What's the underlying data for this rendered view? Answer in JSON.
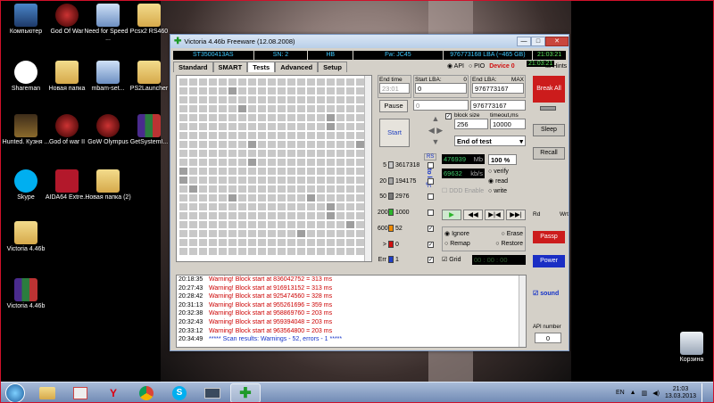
{
  "desktop": {
    "icons": [
      {
        "label": "Компьютер"
      },
      {
        "label": "God Of War"
      },
      {
        "label": "Need for Speed - ..."
      },
      {
        "label": "Pcsx2 RS460"
      },
      {
        "label": "Shareman"
      },
      {
        "label": "Новая папка"
      },
      {
        "label": "mbam-set..."
      },
      {
        "label": "PS2Launcher"
      },
      {
        "label": "Hunted. Кузня ..."
      },
      {
        "label": "God of war II"
      },
      {
        "label": "GoW Olympus"
      },
      {
        "label": "GetSystemI..."
      },
      {
        "label": "Skype"
      },
      {
        "label": "AIDA64 Extre..."
      },
      {
        "label": "Новая папка (2)"
      },
      {
        "label": "Victoria 4.46b"
      },
      {
        "label": "Victoria 4.46b"
      }
    ],
    "recycle_bin": "Корзина"
  },
  "window": {
    "title": "Victoria 4.46b Freeware (12.08.2008)",
    "controls": {
      "minimize": "—",
      "maximize": "□",
      "close": "✕"
    },
    "info": {
      "model": "ST3500413AS",
      "sn": "SN: 2",
      "sn_unit": "HB",
      "fw": "Fw: JC45",
      "lba": "976773168 LBA (~465 GB)",
      "clock": "21:03:21"
    },
    "tabs": [
      "Standard",
      "SMART",
      "Tests",
      "Advanced",
      "Setup"
    ],
    "api": "API",
    "pio": "PIO",
    "device": "Device 0",
    "hints": "Hints",
    "end_time_label": "End time",
    "end_time": "23:01",
    "start_lba_label": "Start LBA:",
    "start_lba_small": "0",
    "start_lba": "0",
    "end_lba_label": "End LBA:",
    "end_lba_max": "MAX",
    "end_lba": "976773167",
    "end_lba2": "976773167",
    "pause": "Pause",
    "pause_field": "0",
    "start": "Start",
    "block_size_label": "block size",
    "block_size": "256",
    "timeout_label": "timeout,ms",
    "timeout": "10000",
    "end_action": "End of test",
    "rs": "RS",
    "to_log": "to log:",
    "legend": [
      {
        "label": "5",
        "count": "3617318",
        "color": "#c8c8c8"
      },
      {
        "label": "20",
        "count": "194175",
        "color": "#a6a6a6"
      },
      {
        "label": "50",
        "count": "2976",
        "color": "#7a7a7a"
      },
      {
        "label": "200",
        "count": "1000",
        "color": "#2bb52b"
      },
      {
        "label": "600",
        "count": "52",
        "color": "#f08a00"
      },
      {
        "label": ">",
        "count": "0",
        "color": "#d01010"
      },
      {
        "label": "Err",
        "count": "1",
        "color": "#1f3fc6"
      }
    ],
    "mb_value": "476939",
    "mb_unit": "Mb",
    "pct": "100",
    "pct_unit": "%",
    "speed": "69632",
    "speed_unit": "kb/s",
    "verify": "verify",
    "read": "read",
    "write": "write",
    "ddd": "DDD Enable",
    "ignore": "Ignore",
    "erase": "Erase",
    "remap": "Remap",
    "restore": "Restore",
    "grid": "Grid",
    "grid_time": "00 : 00 : 00",
    "break_all": "Break All",
    "sleep": "Sleep",
    "recall": "Recall",
    "rd": "Rd",
    "wrt": "Wrt",
    "passp": "Passp",
    "power": "Power",
    "sound": "sound",
    "api_number_label": "API number",
    "api_number": "0",
    "log": [
      {
        "time": "20:18:35",
        "msg": "Warning! Block start at 836042752 = 313 ms",
        "type": "warn"
      },
      {
        "time": "20:27:43",
        "msg": "Warning! Block start at 916913152 = 313 ms",
        "type": "warn"
      },
      {
        "time": "20:28:42",
        "msg": "Warning! Block start at 925474560 = 328 ms",
        "type": "warn"
      },
      {
        "time": "20:31:13",
        "msg": "Warning! Block start at 955261696 = 359 ms",
        "type": "warn"
      },
      {
        "time": "20:32:38",
        "msg": "Warning! Block start at 958869760 = 203 ms",
        "type": "warn"
      },
      {
        "time": "20:32:43",
        "msg": "Warning! Block start at 959394048 = 203 ms",
        "type": "warn"
      },
      {
        "time": "20:33:12",
        "msg": "Warning! Block start at 963564800 = 203 ms",
        "type": "warn"
      },
      {
        "time": "20:34:49",
        "msg": "***** Scan results: Warnings - 52, errors - 1 *****",
        "type": "info"
      }
    ]
  },
  "taskbar": {
    "lang": "EN",
    "time": "21:03",
    "date": "13.03.2013"
  }
}
